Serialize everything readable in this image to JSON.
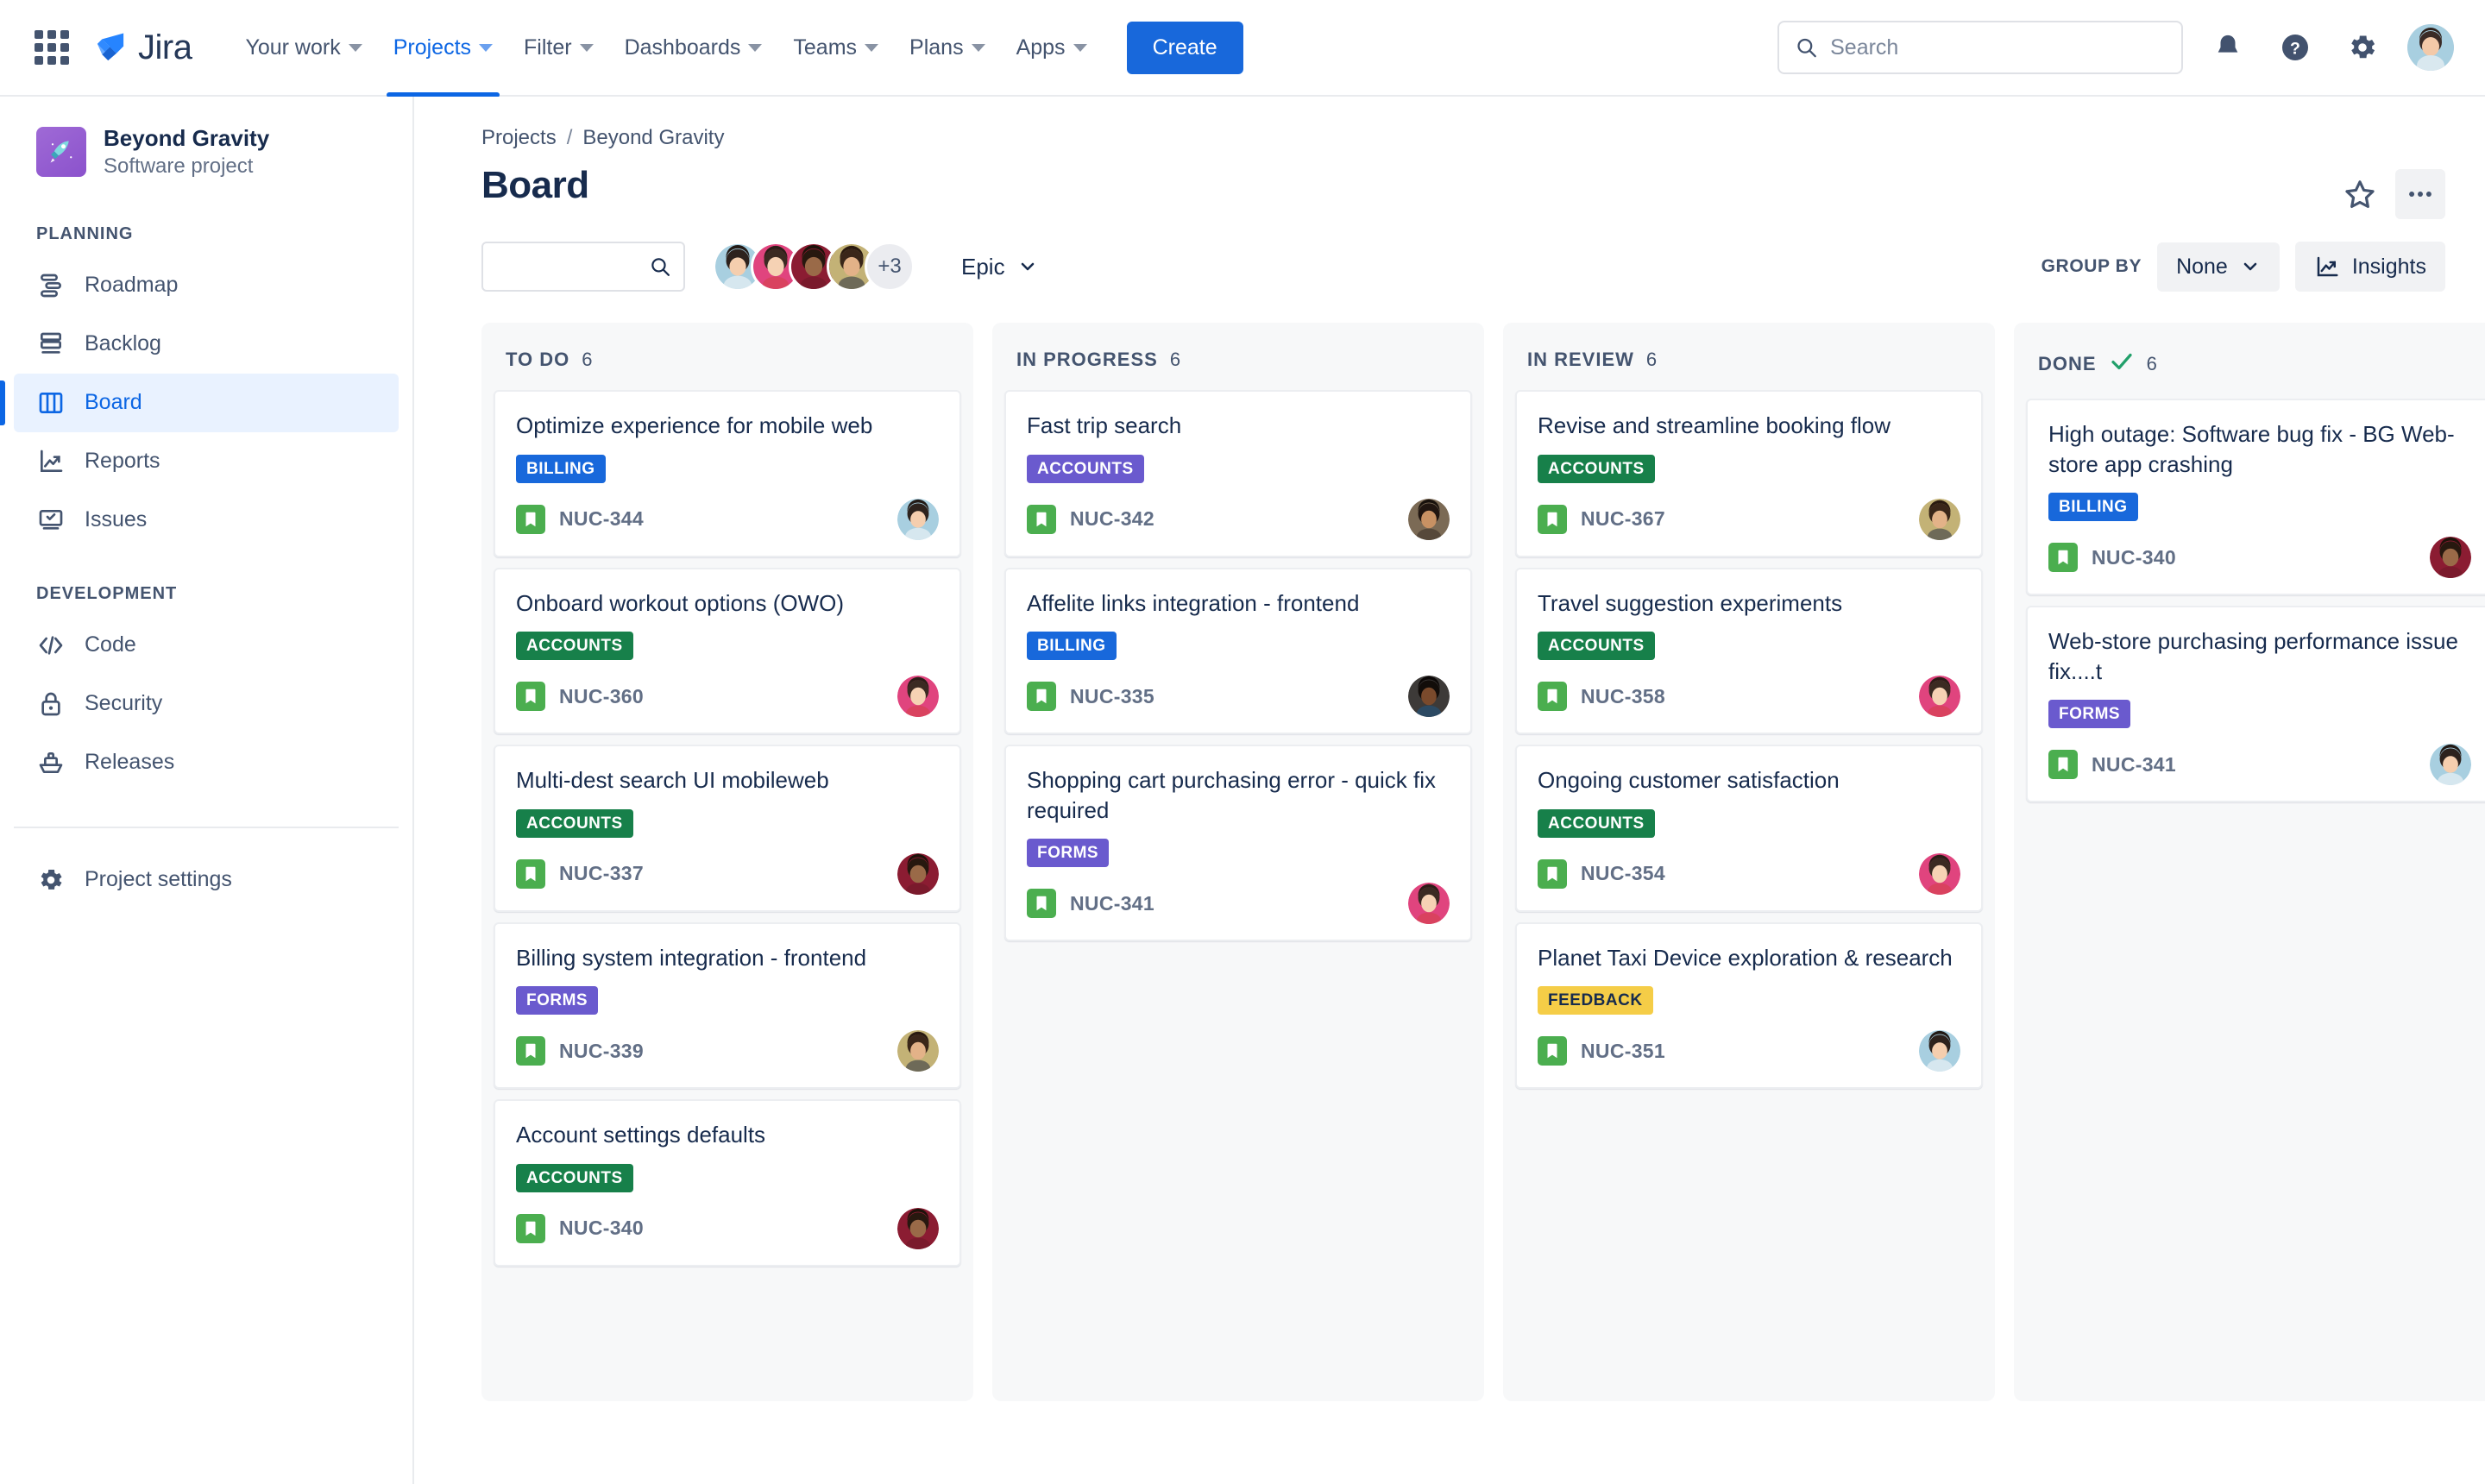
{
  "topnav": {
    "app_switcher": "app-switcher",
    "brand": "Jira",
    "items": [
      {
        "label": "Your work",
        "has_caret": true,
        "active": false
      },
      {
        "label": "Projects",
        "has_caret": true,
        "active": true
      },
      {
        "label": "Filter",
        "has_caret": true,
        "active": false
      },
      {
        "label": "Dashboards",
        "has_caret": true,
        "active": false
      },
      {
        "label": "Teams",
        "has_caret": true,
        "active": false
      },
      {
        "label": "Plans",
        "has_caret": true,
        "active": false
      },
      {
        "label": "Apps",
        "has_caret": true,
        "active": false
      }
    ],
    "create_label": "Create",
    "search_placeholder": "Search",
    "search_value": ""
  },
  "sidebar": {
    "project_name": "Beyond Gravity",
    "project_type": "Software project",
    "sections": [
      {
        "title": "PLANNING",
        "items": [
          {
            "label": "Roadmap",
            "icon": "roadmap-icon",
            "active": false
          },
          {
            "label": "Backlog",
            "icon": "backlog-icon",
            "active": false
          },
          {
            "label": "Board",
            "icon": "board-icon",
            "active": true
          },
          {
            "label": "Reports",
            "icon": "reports-icon",
            "active": false
          },
          {
            "label": "Issues",
            "icon": "issues-icon",
            "active": false
          }
        ]
      },
      {
        "title": "DEVELOPMENT",
        "items": [
          {
            "label": "Code",
            "icon": "code-icon",
            "active": false
          },
          {
            "label": "Security",
            "icon": "lock-icon",
            "active": false
          },
          {
            "label": "Releases",
            "icon": "releases-icon",
            "active": false
          }
        ]
      }
    ],
    "settings_label": "Project settings"
  },
  "header": {
    "breadcrumb": [
      "Projects",
      "Beyond Gravity"
    ],
    "breadcrumb_separator": "/",
    "title": "Board"
  },
  "toolbar": {
    "search_value": "",
    "avatar_overflow": "+3",
    "avatar_count": 4,
    "epic_label": "Epic",
    "group_by_label": "GROUP BY",
    "group_by_value": "None",
    "insights_label": "Insights"
  },
  "colors": {
    "billing": "#1868db",
    "accounts_green": "#17804a",
    "accounts_purple": "#6a5ace",
    "forms": "#6a5ace",
    "feedback": "#f5cd47",
    "feedback_text": "#172b4d",
    "story_icon": "#4bae4f",
    "accent": "#0c66e4",
    "done_check": "#22a06b"
  },
  "board": {
    "columns": [
      {
        "name": "TO DO",
        "count": "6",
        "done": false,
        "cards": [
          {
            "title": "Optimize experience for mobile web",
            "chip": "BILLING",
            "chip_color": "#1868db",
            "chip_text": "#ffffff",
            "key": "NUC-344",
            "avatar": "av1"
          },
          {
            "title": "Onboard workout options (OWO)",
            "chip": "ACCOUNTS",
            "chip_color": "#17804a",
            "chip_text": "#ffffff",
            "key": "NUC-360",
            "avatar": "av2"
          },
          {
            "title": "Multi-dest search UI mobileweb",
            "chip": "ACCOUNTS",
            "chip_color": "#17804a",
            "chip_text": "#ffffff",
            "key": "NUC-337",
            "avatar": "av3"
          },
          {
            "title": "Billing system integration - frontend",
            "chip": "FORMS",
            "chip_color": "#6a5ace",
            "chip_text": "#ffffff",
            "key": "NUC-339",
            "avatar": "av4"
          },
          {
            "title": "Account settings defaults",
            "chip": "ACCOUNTS",
            "chip_color": "#17804a",
            "chip_text": "#ffffff",
            "key": "NUC-340",
            "avatar": "av3"
          }
        ]
      },
      {
        "name": "IN PROGRESS",
        "count": "6",
        "done": false,
        "cards": [
          {
            "title": "Fast trip search",
            "chip": "ACCOUNTS",
            "chip_color": "#6a5ace",
            "chip_text": "#ffffff",
            "key": "NUC-342",
            "avatar": "av5"
          },
          {
            "title": "Affelite links integration - frontend",
            "chip": "BILLING",
            "chip_color": "#1868db",
            "chip_text": "#ffffff",
            "key": "NUC-335",
            "avatar": "av6"
          },
          {
            "title": "Shopping cart purchasing error - quick fix required",
            "chip": "FORMS",
            "chip_color": "#6a5ace",
            "chip_text": "#ffffff",
            "key": "NUC-341",
            "avatar": "av2"
          }
        ]
      },
      {
        "name": "IN REVIEW",
        "count": "6",
        "done": false,
        "cards": [
          {
            "title": "Revise and streamline booking flow",
            "chip": "ACCOUNTS",
            "chip_color": "#17804a",
            "chip_text": "#ffffff",
            "key": "NUC-367",
            "avatar": "av4"
          },
          {
            "title": "Travel suggestion experiments",
            "chip": "ACCOUNTS",
            "chip_color": "#17804a",
            "chip_text": "#ffffff",
            "key": "NUC-358",
            "avatar": "av2"
          },
          {
            "title": "Ongoing customer satisfaction",
            "chip": "ACCOUNTS",
            "chip_color": "#17804a",
            "chip_text": "#ffffff",
            "key": "NUC-354",
            "avatar": "av2"
          },
          {
            "title": "Planet Taxi Device exploration & research",
            "chip": "FEEDBACK",
            "chip_color": "#f5cd47",
            "chip_text": "#172b4d",
            "key": "NUC-351",
            "avatar": "av1"
          }
        ]
      },
      {
        "name": "DONE",
        "count": "6",
        "done": true,
        "cards": [
          {
            "title": "High outage: Software bug fix - BG Web-store app crashing",
            "chip": "BILLING",
            "chip_color": "#1868db",
            "chip_text": "#ffffff",
            "key": "NUC-340",
            "avatar": "av3"
          },
          {
            "title": "Web-store purchasing performance issue fix....t",
            "chip": "FORMS",
            "chip_color": "#6a5ace",
            "chip_text": "#ffffff",
            "key": "NUC-341",
            "avatar": "av1"
          }
        ]
      }
    ],
    "add_column_label": "+"
  }
}
